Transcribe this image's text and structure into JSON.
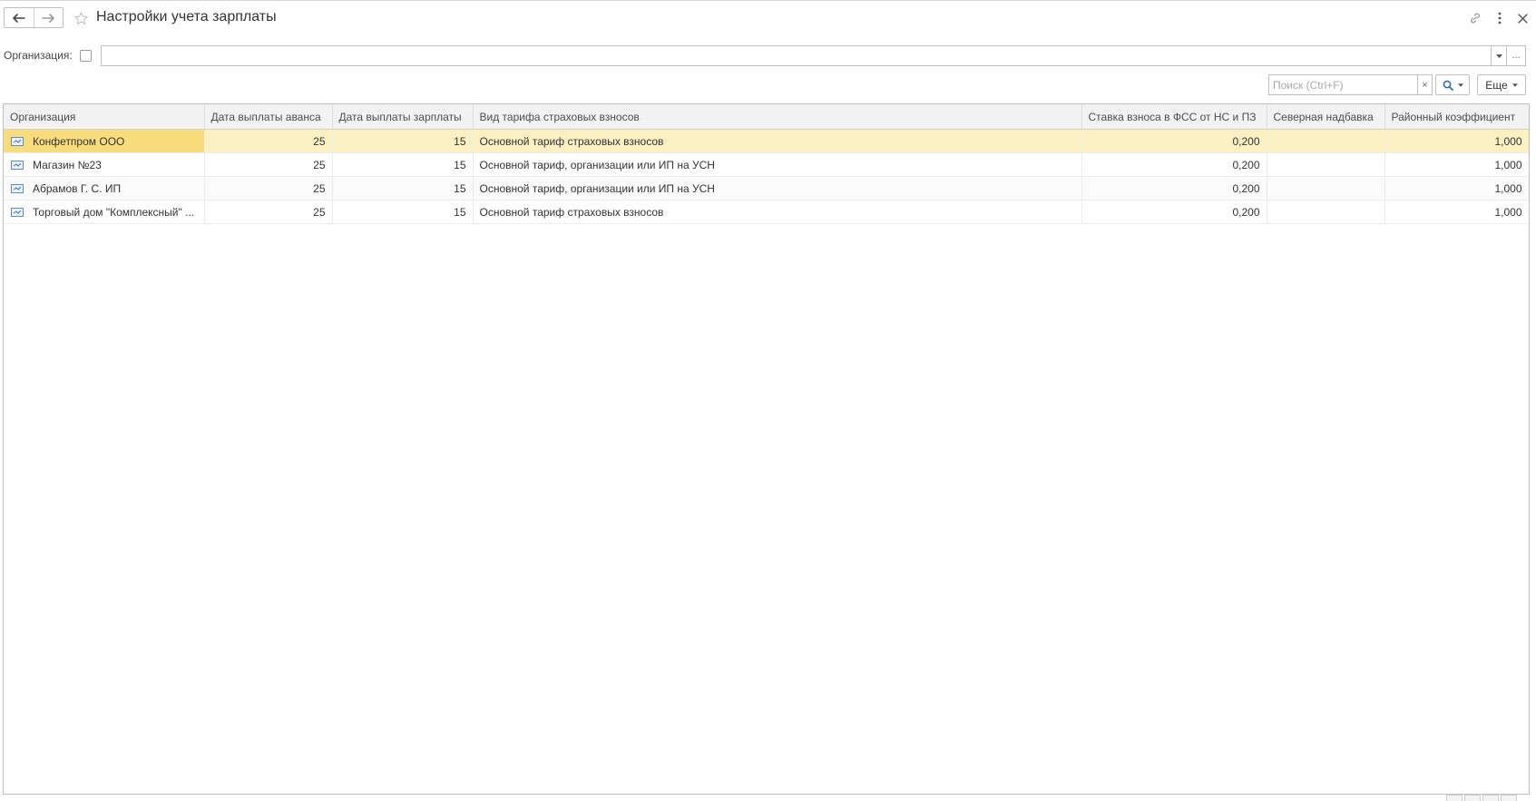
{
  "window": {
    "title": "Настройки учета зарплаты"
  },
  "icons": {
    "back": "arrow-left-icon",
    "forward": "arrow-right-icon",
    "favorite": "star-icon",
    "link": "link-icon",
    "menu": "more-vertical-icon",
    "close": "close-icon"
  },
  "filter": {
    "label": "Организация:",
    "checked": false,
    "value": "",
    "more_label": "..."
  },
  "search": {
    "placeholder": "Поиск (Ctrl+F)",
    "value": "",
    "clear_label": "×"
  },
  "toolbar": {
    "more_label": "Еще"
  },
  "table": {
    "columns": [
      "Организация",
      "Дата выплаты аванса",
      "Дата выплаты зарплаты",
      "Вид тарифа страховых взносов",
      "Ставка взноса в ФСС от НС и ПЗ",
      "Северная надбавка",
      "Районный коэффициент"
    ],
    "rows": [
      {
        "org": "Конфетпром ООО",
        "advance_day": "25",
        "salary_day": "15",
        "tariff": "Основной тариф страховых взносов",
        "fss_rate": "0,200",
        "northern": "",
        "district": "1,000",
        "selected": true
      },
      {
        "org": "Магазин №23",
        "advance_day": "25",
        "salary_day": "15",
        "tariff": "Основной тариф, организации или ИП на УСН",
        "fss_rate": "0,200",
        "northern": "",
        "district": "1,000",
        "selected": false
      },
      {
        "org": "Абрамов Г. С. ИП",
        "advance_day": "25",
        "salary_day": "15",
        "tariff": "Основной тариф, организации или ИП на УСН",
        "fss_rate": "0,200",
        "northern": "",
        "district": "1,000",
        "selected": false
      },
      {
        "org": "Торговый дом \"Комплексный\" ...",
        "advance_day": "25",
        "salary_day": "15",
        "tariff": "Основной тариф страховых взносов",
        "fss_rate": "0,200",
        "northern": "",
        "district": "1,000",
        "selected": false
      }
    ]
  },
  "colors": {
    "selected_row": "#fbf0c2",
    "active_cell": "#f9dc7c",
    "header_bg": "#f2f2f2",
    "border": "#bfbfbf"
  }
}
